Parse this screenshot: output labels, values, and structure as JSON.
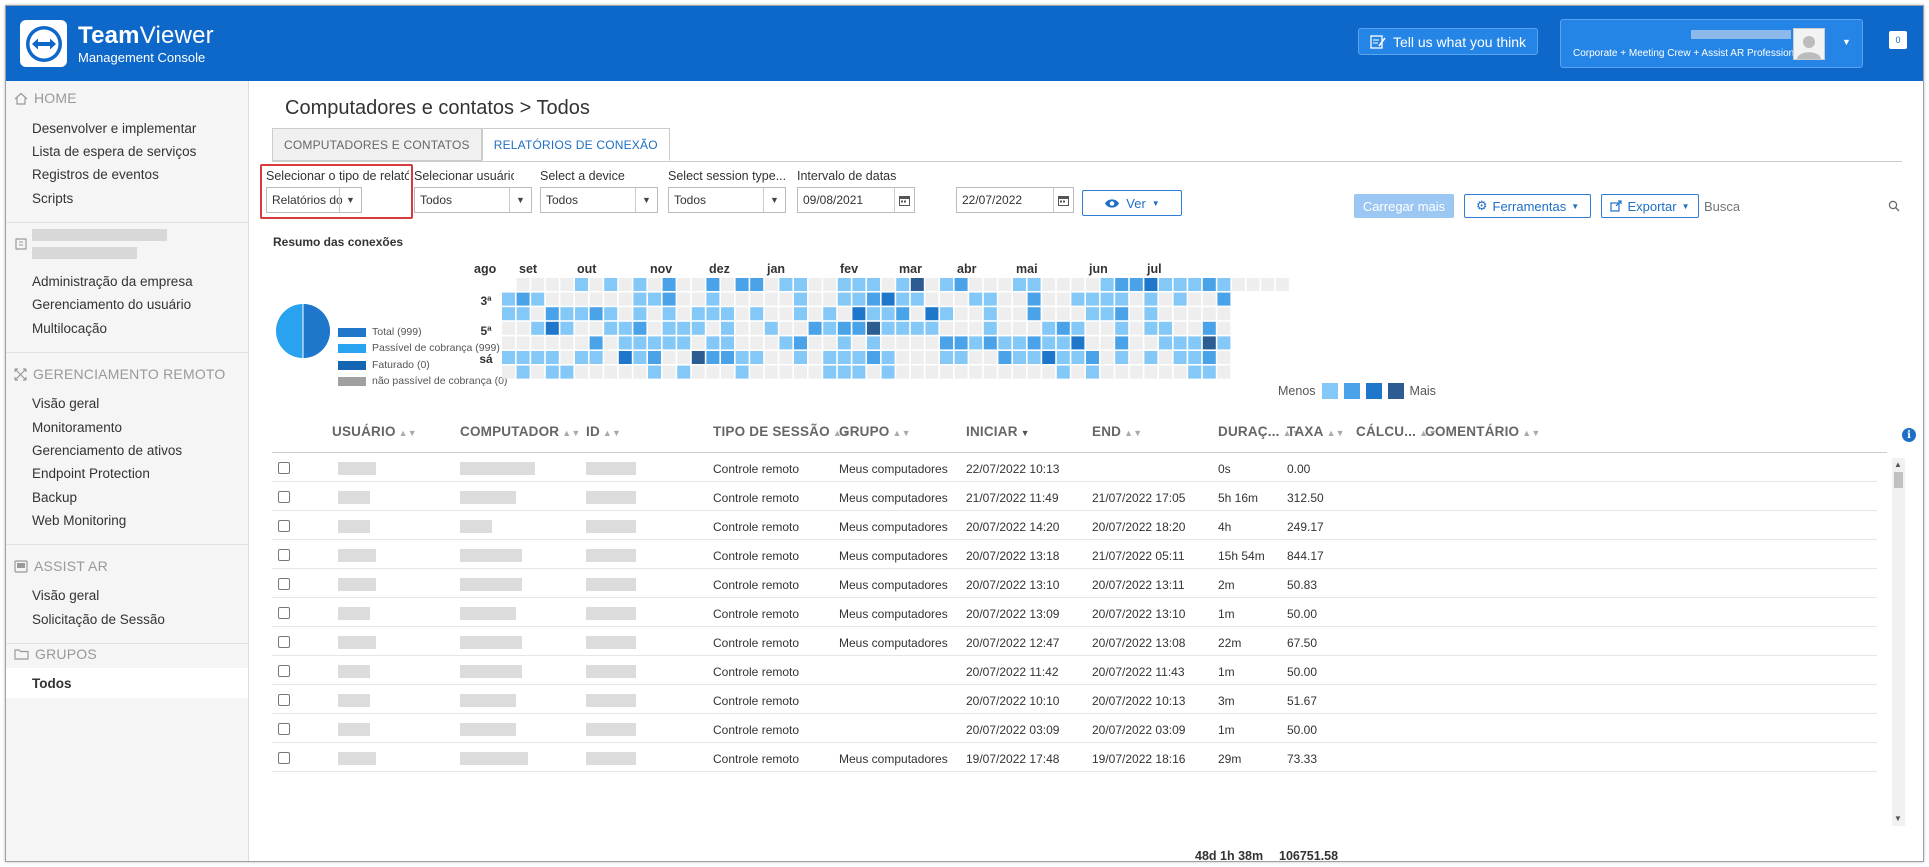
{
  "brand": {
    "name_bold": "Team",
    "name_rest": "Viewer",
    "subtitle": "Management Console"
  },
  "header": {
    "feedback_label": "Tell us what you think",
    "plan_label": "Corporate + Meeting Crew + Assist AR Professional",
    "notification_count": "0"
  },
  "sidebar": {
    "home_label": "HOME",
    "home_items": [
      "Desenvolver e implementar",
      "Lista de espera de serviços",
      "Registros de eventos",
      "Scripts"
    ],
    "company_items": [
      "Administração da empresa",
      "Gerenciamento do usuário",
      "Multilocação"
    ],
    "remote_label": "GERENCIAMENTO REMOTO",
    "remote_items": [
      "Visão geral",
      "Monitoramento",
      "Gerenciamento de ativos",
      "Endpoint Protection",
      "Backup",
      "Web Monitoring"
    ],
    "assist_label": "ASSIST AR",
    "assist_items": [
      "Visão geral",
      "Solicitação de Sessão"
    ],
    "groups_label": "GRUPOS",
    "groups_items": [
      "Todos"
    ]
  },
  "main": {
    "title": "Computadores e contatos > Todos",
    "tabs": [
      "COMPUTADORES E CONTATOS",
      "RELATÓRIOS DE CONEXÃO"
    ],
    "filters": {
      "report_type_label": "Selecionar o tipo de relatório...",
      "report_type_value": "Relatórios do us",
      "user_label": "Selecionar usuário...",
      "user_value": "Todos",
      "device_label": "Select a device",
      "device_value": "Todos",
      "session_label": "Select session type...",
      "session_value": "Todos",
      "date_label": "Intervalo de datas",
      "date_from": "09/08/2021",
      "date_to": "22/07/2022",
      "view_label": "Ver"
    },
    "toolbar": {
      "load_more": "Carregar mais",
      "tools": "Ferramentas",
      "export": "Exportar",
      "search_placeholder": "Busca"
    },
    "summary": {
      "title": "Resumo das conexões",
      "legend": [
        "Total (999)",
        "Passível de cobrança (999)",
        "Faturado (0)",
        "não passível de cobrança (0)"
      ],
      "pie": [
        {
          "name": "Total (999)",
          "value": 999
        },
        {
          "name": "Passível de cobrança (999)",
          "value": 999
        },
        {
          "name": "Faturado (0)",
          "value": 0
        },
        {
          "name": "não passível de cobrança (0)",
          "value": 0
        }
      ]
    },
    "heatmap": {
      "months": [
        "ago",
        "set",
        "out",
        "nov",
        "dez",
        "jan",
        "fev",
        "mar",
        "abr",
        "mai",
        "jun",
        "jul"
      ],
      "day_labels": [
        "3ª",
        "5ª",
        "sá"
      ],
      "legend_less": "Menos",
      "legend_more": "Mais"
    },
    "table": {
      "columns": [
        "USUÁRIO",
        "COMPUTADOR",
        "ID",
        "TIPO DE SESSÃO",
        "GRUPO",
        "INICIAR",
        "END",
        "DURAÇ...",
        "TAXA",
        "CÁLCU...",
        "COMENTÁRIO"
      ],
      "rows": [
        {
          "type": "Controle remoto",
          "group": "Meus computadores",
          "start": "22/07/2022 10:13",
          "end": "",
          "duration": "0s",
          "rate": "0.00"
        },
        {
          "type": "Controle remoto",
          "group": "Meus computadores",
          "start": "21/07/2022 11:49",
          "end": "21/07/2022 17:05",
          "duration": "5h 16m",
          "rate": "312.50"
        },
        {
          "type": "Controle remoto",
          "group": "Meus computadores",
          "start": "20/07/2022 14:20",
          "end": "20/07/2022 18:20",
          "duration": "4h",
          "rate": "249.17"
        },
        {
          "type": "Controle remoto",
          "group": "Meus computadores",
          "start": "20/07/2022 13:18",
          "end": "21/07/2022 05:11",
          "duration": "15h 54m",
          "rate": "844.17"
        },
        {
          "type": "Controle remoto",
          "group": "Meus computadores",
          "start": "20/07/2022 13:10",
          "end": "20/07/2022 13:11",
          "duration": "2m",
          "rate": "50.83"
        },
        {
          "type": "Controle remoto",
          "group": "Meus computadores",
          "start": "20/07/2022 13:09",
          "end": "20/07/2022 13:10",
          "duration": "1m",
          "rate": "50.00"
        },
        {
          "type": "Controle remoto",
          "group": "Meus computadores",
          "start": "20/07/2022 12:47",
          "end": "20/07/2022 13:08",
          "duration": "22m",
          "rate": "67.50"
        },
        {
          "type": "Controle remoto",
          "group": "",
          "start": "20/07/2022 11:42",
          "end": "20/07/2022 11:43",
          "duration": "1m",
          "rate": "50.00"
        },
        {
          "type": "Controle remoto",
          "group": "",
          "start": "20/07/2022 10:10",
          "end": "20/07/2022 10:13",
          "duration": "3m",
          "rate": "51.67"
        },
        {
          "type": "Controle remoto",
          "group": "",
          "start": "20/07/2022 03:09",
          "end": "20/07/2022 03:09",
          "duration": "1m",
          "rate": "50.00"
        },
        {
          "type": "Controle remoto",
          "group": "Meus computadores",
          "start": "19/07/2022 17:48",
          "end": "19/07/2022 18:16",
          "duration": "29m",
          "rate": "73.33"
        }
      ],
      "total_duration": "48d 1h 38m",
      "total_rate": "106751.58"
    }
  },
  "colors": {
    "brand_blue": "#0e68c9",
    "heat_1": "#84c8f7",
    "heat_2": "#4aa3e8",
    "heat_3": "#1f77cc",
    "heat_4": "#2c5c92",
    "heat_empty": "#eeeeee"
  }
}
